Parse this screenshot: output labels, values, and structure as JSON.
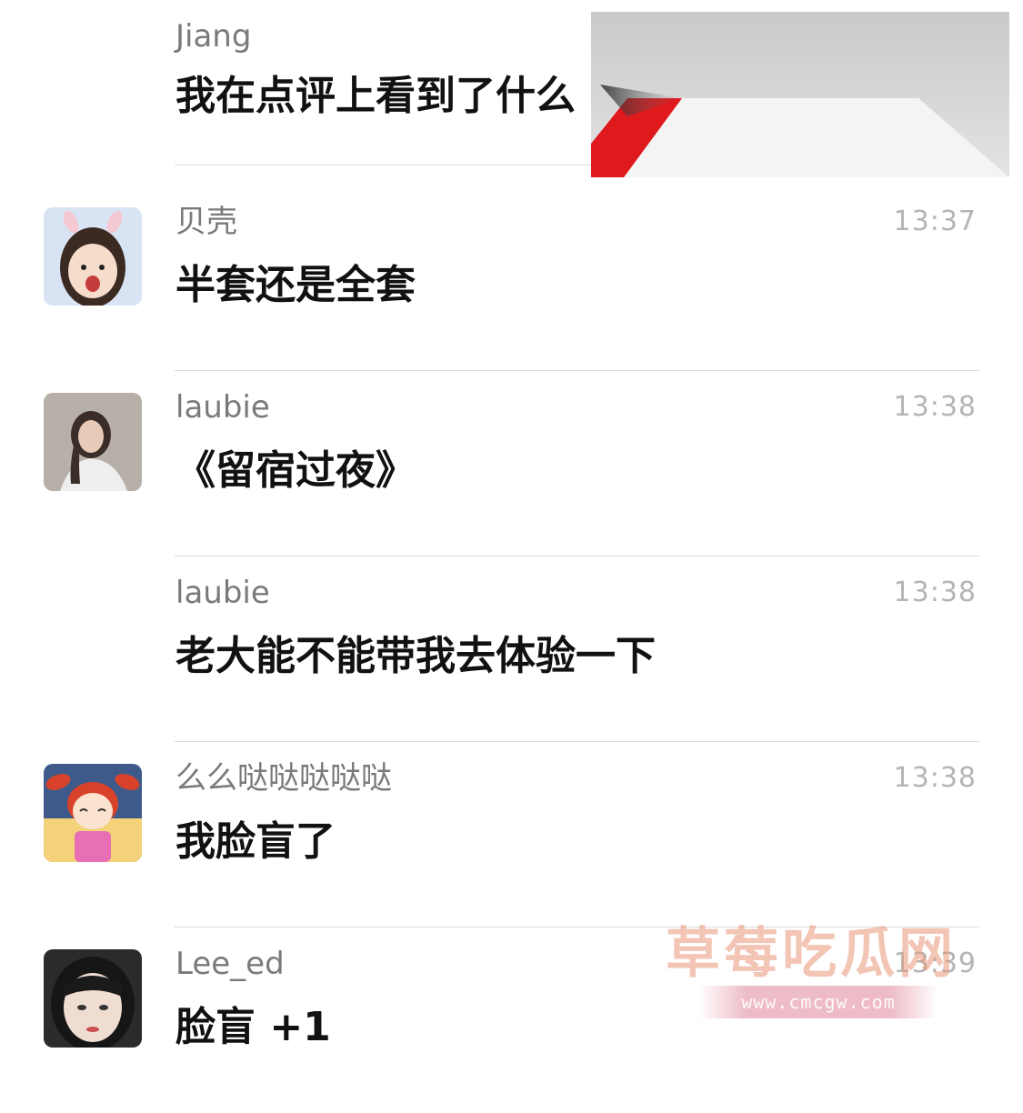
{
  "messages": [
    {
      "name": "Jiang",
      "time": "",
      "text": "我在点评上看到了什么"
    },
    {
      "name": "贝壳",
      "time": "13:37",
      "text": "半套还是全套"
    },
    {
      "name": "laubie",
      "time": "13:38",
      "text": "《留宿过夜》"
    },
    {
      "name": "laubie",
      "time": "13:38",
      "text": "老大能不能带我去体验一下"
    },
    {
      "name": "么么哒哒哒哒哒",
      "time": "13:38",
      "text": "我脸盲了"
    },
    {
      "name": "Lee_ed",
      "time": "13:39",
      "text": "脸盲 +1"
    }
  ],
  "watermark": {
    "title": "草莓吃瓜网",
    "url": "www.cmcgw.com"
  },
  "colors": {
    "name": "#7a7a7a",
    "time": "#b5b5b5",
    "text": "#111111",
    "divider": "#dcdcdc",
    "shared_image_accent": "#e0191d"
  }
}
